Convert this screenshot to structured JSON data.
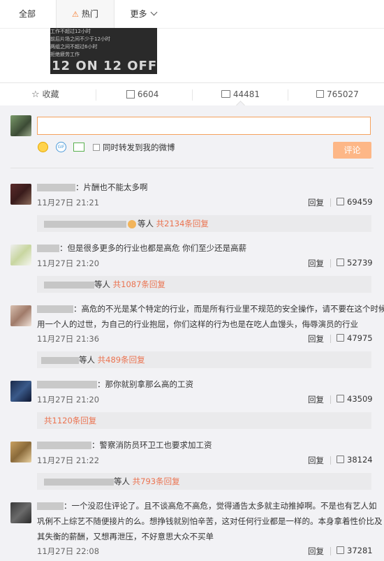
{
  "tabs": {
    "all": "全部",
    "hot": "热门",
    "more": "更多"
  },
  "poster": {
    "lines": [
      "工作不超过12小时",
      "前后片场之间不少于12小时",
      "两组之间不超过6小时",
      "拒绝疲劳工作"
    ],
    "big": "12 ON 12 OFF"
  },
  "actions": {
    "favorite": "收藏",
    "repost": "6604",
    "comment": "44481",
    "like": "765027"
  },
  "composer": {
    "placeholder": "",
    "sync_label": "同时转发到我的微博",
    "submit": "评论"
  },
  "comments": [
    {
      "text": "：片酬也不能太多啊",
      "time": "11月27日 21:21",
      "reply": "回复",
      "likes": "69459",
      "sub": {
        "who": "等人",
        "link": "共2134条回复"
      }
    },
    {
      "text": "：但是很多更多的行业也都是高危 你们至少还是高薪",
      "time": "11月27日 21:20",
      "reply": "回复",
      "likes": "52739",
      "sub": {
        "who": "等人",
        "link": "共1087条回复"
      }
    },
    {
      "text_line1": "：高危的不光是某个特定的行业，而是所有行业里不规范的安全操作，请不要在这个时候",
      "text_line2": "用一个人的过世，为自己的行业抱屈，你们这样的行为也是在吃人血馒头，侮辱演员的行业",
      "time": "11月27日 21:36",
      "reply": "回复",
      "likes": "47975",
      "sub": {
        "who": "等人",
        "link": "共489条回复"
      }
    },
    {
      "text": "：那你就别拿那么高的工资",
      "time": "11月27日 21:20",
      "reply": "回复",
      "likes": "43509",
      "sub": {
        "who": "",
        "link": "共1120条回复"
      }
    },
    {
      "text": "：警察消防员环卫工也要求加工资",
      "time": "11月27日 21:22",
      "reply": "回复",
      "likes": "38124",
      "sub": {
        "who": "等人",
        "link": "共793条回复"
      }
    },
    {
      "text_line1": "：一个没忍住评论了。且不谈高危不高危，觉得通告太多就主动推掉啊。不是也有艺人如",
      "text_line2": "巩俐不上综艺不随便接片的么。想挣钱就别怕辛苦，这对任何行业都是一样的。本身拿着性价比及",
      "text_line3": "其失衡的薪酬，又想再泄压，不好意思大众不买单",
      "time": "11月27日 22:08",
      "reply": "回复",
      "likes": "37281"
    }
  ]
}
